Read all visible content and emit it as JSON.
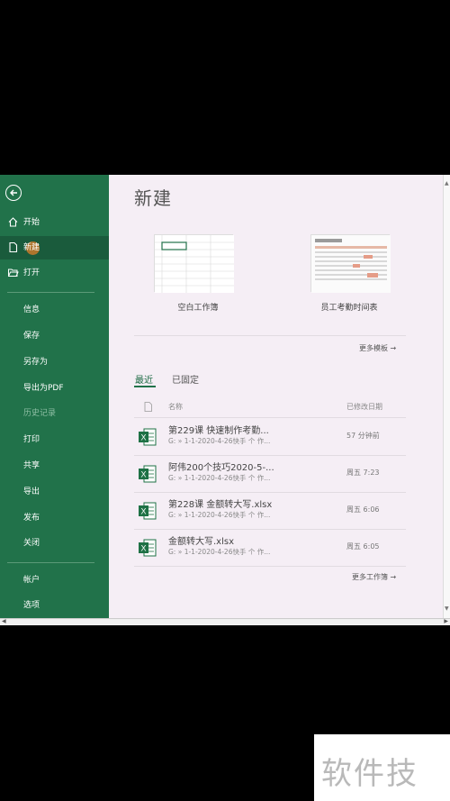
{
  "sidebar": {
    "items": [
      {
        "label": "开始",
        "icon": "home-icon"
      },
      {
        "label": "新建",
        "icon": "new-file-icon"
      },
      {
        "label": "打开",
        "icon": "open-folder-icon"
      },
      {
        "label": "信息"
      },
      {
        "label": "保存"
      },
      {
        "label": "另存为"
      },
      {
        "label": "导出为PDF"
      },
      {
        "label": "历史记录"
      },
      {
        "label": "打印"
      },
      {
        "label": "共享"
      },
      {
        "label": "导出"
      },
      {
        "label": "发布"
      },
      {
        "label": "关闭"
      },
      {
        "label": "帐户"
      },
      {
        "label": "选项"
      }
    ]
  },
  "main": {
    "title": "新建",
    "templates": [
      {
        "label": "空白工作簿"
      },
      {
        "label": "员工考勤时间表"
      }
    ],
    "more_templates": "更多模板",
    "tabs": [
      {
        "label": "最近"
      },
      {
        "label": "已固定"
      }
    ],
    "columns": {
      "name": "名称",
      "modified": "已修改日期"
    },
    "files": [
      {
        "name": "第229课 快速制作考勤...",
        "path": "G: » 1-1-2020-4-26快手 个 作...",
        "date": "57 分钟前"
      },
      {
        "name": "阿伟200个技巧2020-5-...",
        "path": "G: » 1-1-2020-4-26快手 个 作...",
        "date": "周五 7:23"
      },
      {
        "name": "第228课 金额转大写.xlsx",
        "path": "G: » 1-1-2020-4-26快手 个 作...",
        "date": "周五 6:06"
      },
      {
        "name": "金额转大写.xlsx",
        "path": "G: » 1-1-2020-4-26快手 个 作...",
        "date": "周五 6:05"
      }
    ],
    "more_workbooks": "更多工作簿"
  },
  "watermark": "软件技巧",
  "colors": {
    "sidebar": "#21724a",
    "sidebar_active": "#1a5b3c",
    "main_bg": "#f5eef5",
    "excel_green": "#1e7145"
  }
}
